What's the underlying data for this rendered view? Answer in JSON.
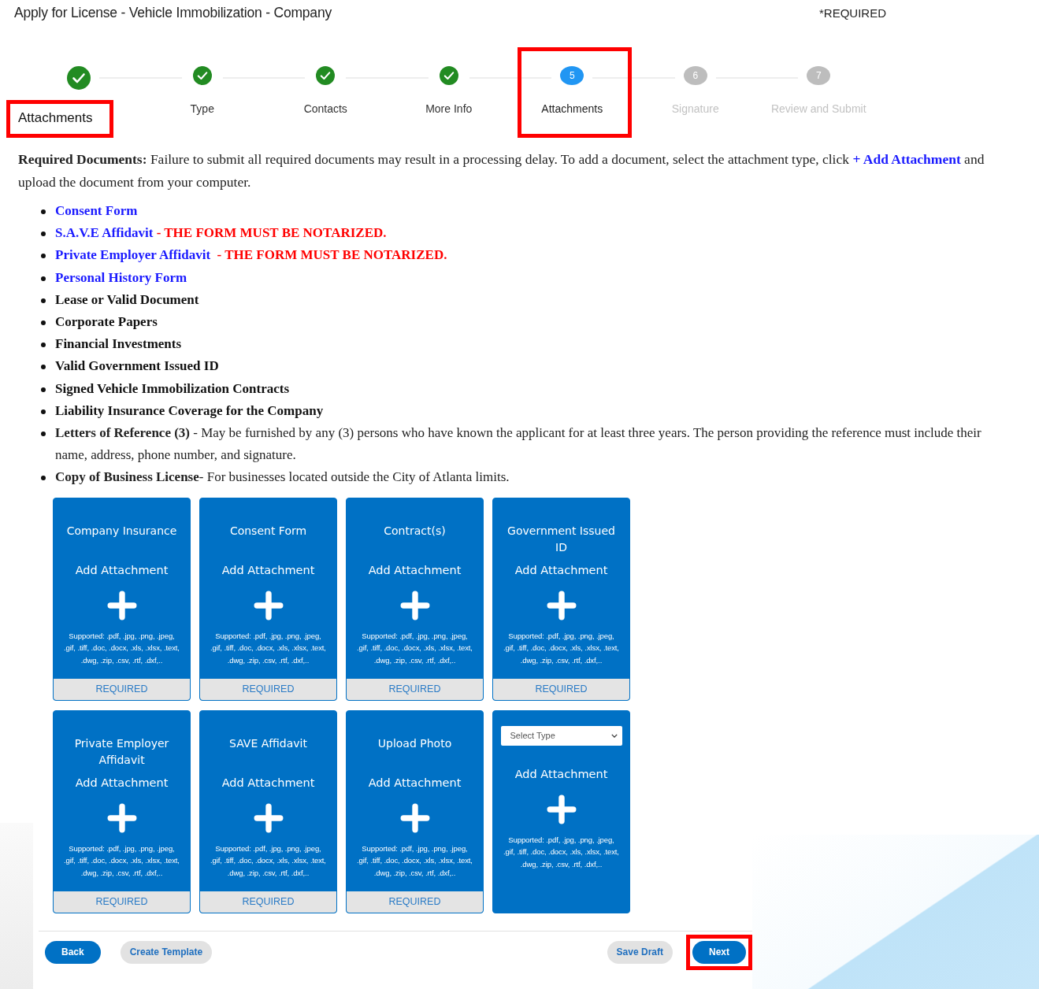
{
  "header": {
    "title": "Apply for License - Vehicle Immobilization - Company",
    "required_note": "*REQUIRED"
  },
  "steps": [
    {
      "kind": "complete",
      "highlighted": false
    },
    {
      "label": "Type",
      "kind": "complete",
      "highlighted": false
    },
    {
      "label": "Contacts",
      "kind": "complete",
      "highlighted": false
    },
    {
      "label": "More Info",
      "kind": "complete",
      "highlighted": false
    },
    {
      "number": "5",
      "label": "Attachments",
      "kind": "current",
      "highlighted": true
    },
    {
      "number": "6",
      "label": "Signature",
      "kind": "pending",
      "highlighted": false
    },
    {
      "number": "7",
      "label": "Review and Submit",
      "kind": "pending",
      "highlighted": false
    }
  ],
  "section": {
    "title": "Attachments",
    "highlighted": true
  },
  "intro": {
    "before": "**Required Documents:** Failure to submit all required documents may result in a processing delay. To add a document, select the attachment type, click",
    "link": "+ Add Attachment",
    "after": "and upload the document from your computer."
  },
  "documents": [
    {
      "kind": "link",
      "link": "Consent Form"
    },
    {
      "kind": "link",
      "link": "S.A.V.E Affidavit",
      "notice": "- THE FORM MUST BE NOTARIZED."
    },
    {
      "kind": "link",
      "link": "Private Employer Affidavit",
      "notice": " - THE FORM MUST BE NOTARIZED."
    },
    {
      "kind": "link",
      "link": "Personal History Form"
    },
    {
      "kind": "bold",
      "text": "Lease or Valid Document"
    },
    {
      "kind": "bold",
      "text": "Corporate Papers"
    },
    {
      "kind": "bold",
      "text": "Financial Investments"
    },
    {
      "kind": "bold",
      "text": "Valid Government Issued ID"
    },
    {
      "kind": "bold",
      "text": "Signed Vehicle Immobilization Contracts"
    },
    {
      "kind": "bold",
      "text": "Liability Insurance Coverage for the Company"
    },
    {
      "kind": "text",
      "text": "**Letters of Reference (3)** - May be furnished by any (3) persons who have known the applicant for at least three years. The person providing the reference must include their name, address, phone number, and signature."
    },
    {
      "kind": "text",
      "text": "**Copy of Business License**- For businesses located outside the City of Atlanta limits."
    }
  ],
  "cards": [
    {
      "kind": "typed",
      "title": "Company Insurance",
      "action": "Add Attachment",
      "supported": "Supported: .pdf, .jpg, .png, .jpeg, .gif, .tiff, .doc, .docx, .xls, .xlsx, .text, .dwg, .zip, .csv, .rtf, .dxf,..",
      "footer": "REQUIRED"
    },
    {
      "kind": "typed",
      "title": "Consent Form",
      "action": "Add Attachment",
      "supported": "Supported: .pdf, .jpg, .png, .jpeg, .gif, .tiff, .doc, .docx, .xls, .xlsx, .text, .dwg, .zip, .csv, .rtf, .dxf,..",
      "footer": "REQUIRED"
    },
    {
      "kind": "typed",
      "title": "Contract(s)",
      "action": "Add Attachment",
      "supported": "Supported: .pdf, .jpg, .png, .jpeg, .gif, .tiff, .doc, .docx, .xls, .xlsx, .text, .dwg, .zip, .csv, .rtf, .dxf,..",
      "footer": "REQUIRED"
    },
    {
      "kind": "typed",
      "title": "Government Issued ID",
      "action": "Add Attachment",
      "supported": "Supported: .pdf, .jpg, .png, .jpeg, .gif, .tiff, .doc, .docx, .xls, .xlsx, .text, .dwg, .zip, .csv, .rtf, .dxf,..",
      "footer": "REQUIRED"
    },
    {
      "kind": "typed",
      "title": "Private Employer Affidavit",
      "action": "Add Attachment",
      "supported": "Supported: .pdf, .jpg, .png, .jpeg, .gif, .tiff, .doc, .docx, .xls, .xlsx, .text, .dwg, .zip, .csv, .rtf, .dxf,..",
      "footer": "REQUIRED"
    },
    {
      "kind": "typed",
      "title": "SAVE Affidavit",
      "action": "Add Attachment",
      "supported": "Supported: .pdf, .jpg, .png, .jpeg, .gif, .tiff, .doc, .docx, .xls, .xlsx, .text, .dwg, .zip, .csv, .rtf, .dxf,..",
      "footer": "REQUIRED"
    },
    {
      "kind": "typed",
      "title": "Upload Photo",
      "action": "Add Attachment",
      "supported": "Supported: .pdf, .jpg, .png, .jpeg, .gif, .tiff, .doc, .docx, .xls, .xlsx, .text, .dwg, .zip, .csv, .rtf, .dxf,..",
      "footer": "REQUIRED"
    },
    {
      "kind": "select",
      "select": {
        "value": "Select Type"
      },
      "action": "Add Attachment",
      "supported": "Supported: .pdf, .jpg, .png, .jpeg, .gif, .tiff, .doc, .docx, .xls, .xlsx, .text, .dwg, .zip, .csv, .rtf, .dxf,.."
    }
  ],
  "footer": {
    "left_buttons": [
      {
        "label": "Back",
        "kind": "primary",
        "highlighted": false
      },
      {
        "label": "Create Template",
        "kind": "secondary",
        "highlighted": false
      }
    ],
    "right_buttons": [
      {
        "label": "Save Draft",
        "kind": "secondary",
        "highlighted": false
      },
      {
        "label": "Next",
        "kind": "primary",
        "highlighted": true
      }
    ]
  }
}
